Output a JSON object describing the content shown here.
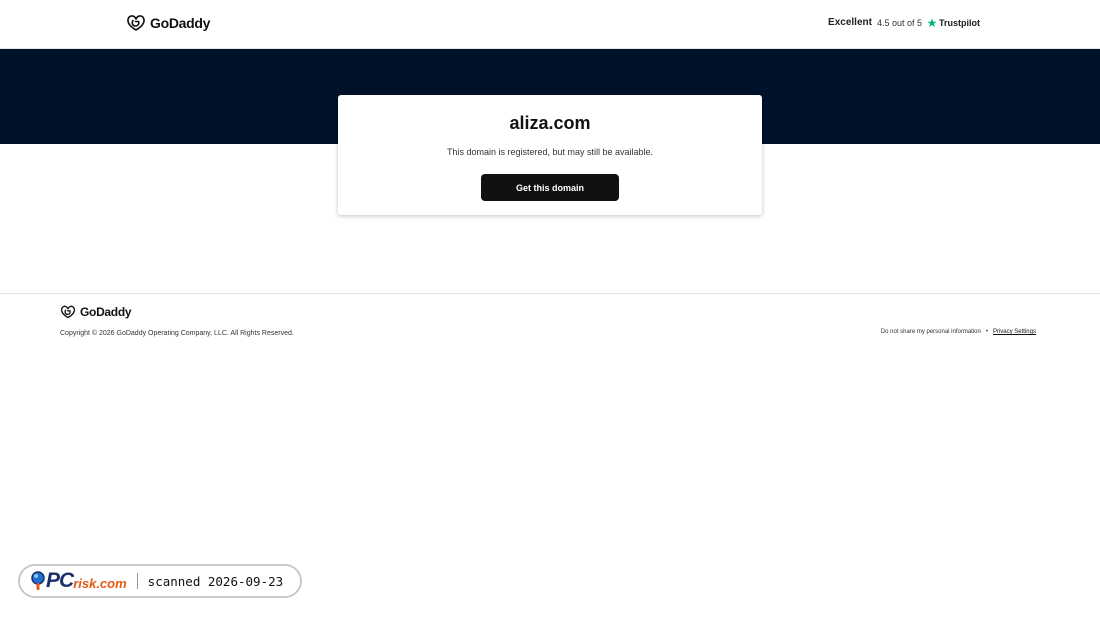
{
  "header": {
    "logo_text": "GoDaddy",
    "rating": {
      "label": "Excellent",
      "score_text": "4.5 out of 5",
      "provider": "Trustpilot",
      "score": 4.5,
      "max": 5
    }
  },
  "card": {
    "domain": "aliza.com",
    "description": "This domain is registered, but may still be available.",
    "cta_label": "Get this domain"
  },
  "footer": {
    "logo_text": "GoDaddy",
    "copyright": "Copyright © 2026 GoDaddy Operating Company, LLC. All Rights Reserved.",
    "do_not_share": "Do not share my personal information",
    "separator": "•",
    "privacy_settings": "Privacy Settings"
  },
  "watermark": {
    "brand_pc": "PC",
    "brand_risk": "risk.com",
    "scanned_text": "scanned 2026-09-23"
  },
  "colors": {
    "hero_band": "#00122a",
    "button": "#111111",
    "trustpilot_star": "#00b67a",
    "pcrisk_blue": "#1c2f6b",
    "pcrisk_orange": "#e35a12"
  },
  "icons": [
    "godaddy-logo-icon",
    "trustpilot-star-icon",
    "pcrisk-magnifier-icon"
  ]
}
